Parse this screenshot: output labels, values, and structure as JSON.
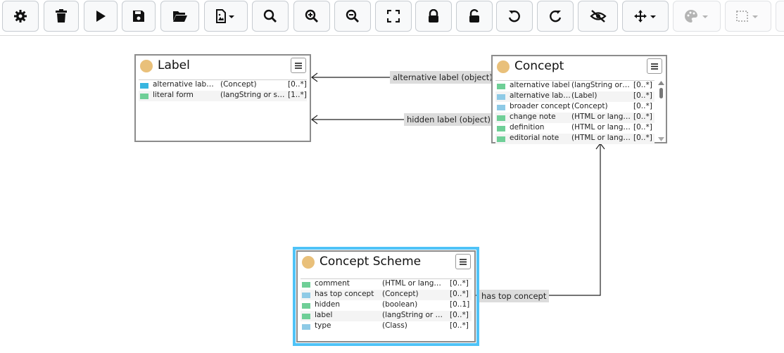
{
  "colors": {
    "accent_selected": "#4fc3f7",
    "class_dot": "#e9c07a",
    "attr_icon": "#6fcf97",
    "rel_icon": "#8ecae6"
  },
  "toolbar": {
    "buttons": [
      {
        "name": "settings-button",
        "icon": "gear-icon"
      },
      {
        "name": "delete-button",
        "icon": "trash-icon"
      },
      {
        "name": "run-layout-button",
        "icon": "play-icon"
      },
      {
        "name": "save-button",
        "icon": "floppy-icon"
      },
      {
        "name": "open-button",
        "icon": "folder-open-icon"
      },
      {
        "name": "export-image-button",
        "icon": "image-file-icon"
      },
      {
        "name": "search-button",
        "icon": "search-icon"
      },
      {
        "name": "zoom-in-button",
        "icon": "zoom-in-icon"
      },
      {
        "name": "zoom-out-button",
        "icon": "zoom-out-icon"
      },
      {
        "name": "fit-button",
        "icon": "fullscreen-icon"
      },
      {
        "name": "lock-button",
        "icon": "lock-icon"
      },
      {
        "name": "unlock-button",
        "icon": "unlock-icon"
      },
      {
        "name": "undo-button",
        "icon": "undo-icon"
      },
      {
        "name": "redo-button",
        "icon": "redo-icon"
      },
      {
        "name": "hide-button",
        "icon": "eye-slash-icon"
      },
      {
        "name": "move-button",
        "icon": "move-icon"
      },
      {
        "name": "color-button",
        "icon": "palette-icon"
      },
      {
        "name": "selection-button",
        "icon": "selection-icon"
      }
    ]
  },
  "nodes": {
    "label": {
      "title": "Label",
      "rows": [
        {
          "icon": "rel-out",
          "name": "alternative label for",
          "type": "(Concept)",
          "card": "[0..*]"
        },
        {
          "icon": "attr",
          "name": "literal form",
          "type": "(langString or stri...",
          "card": "[1..*]"
        }
      ]
    },
    "concept": {
      "title": "Concept",
      "rows": [
        {
          "icon": "attr",
          "name": "alternative label",
          "type": "(langString or str...",
          "card": "[0..*]"
        },
        {
          "icon": "rel",
          "name": "alternative label...",
          "type": "(Label)",
          "card": "[0..*]"
        },
        {
          "icon": "rel",
          "name": "broader concept",
          "type": "(Concept)",
          "card": "[0..*]"
        },
        {
          "icon": "attr",
          "name": "change note",
          "type": "(HTML or langSt...",
          "card": "[0..*]"
        },
        {
          "icon": "attr",
          "name": "definition",
          "type": "(HTML or langSt...",
          "card": "[0..*]"
        },
        {
          "icon": "attr",
          "name": "editorial note",
          "type": "(HTML or langSt...",
          "card": "[0..*]"
        }
      ]
    },
    "concept_scheme": {
      "title": "Concept Scheme",
      "rows": [
        {
          "icon": "attr",
          "name": "comment",
          "type": "(HTML or langStri...",
          "card": "[0..*]"
        },
        {
          "icon": "rel",
          "name": "has top concept",
          "type": "(Concept)",
          "card": "[0..*]"
        },
        {
          "icon": "attr",
          "name": "hidden",
          "type": "(boolean)",
          "card": "[0..1]"
        },
        {
          "icon": "attr",
          "name": "label",
          "type": "(langString or stri...",
          "card": "[0..*]"
        },
        {
          "icon": "rel",
          "name": "type",
          "type": "(Class)",
          "card": "[0..*]"
        }
      ]
    }
  },
  "edges": {
    "alt_label": "alternative label (object)",
    "hidden_label": "hidden label (object)",
    "has_top_concept": "has top concept"
  }
}
